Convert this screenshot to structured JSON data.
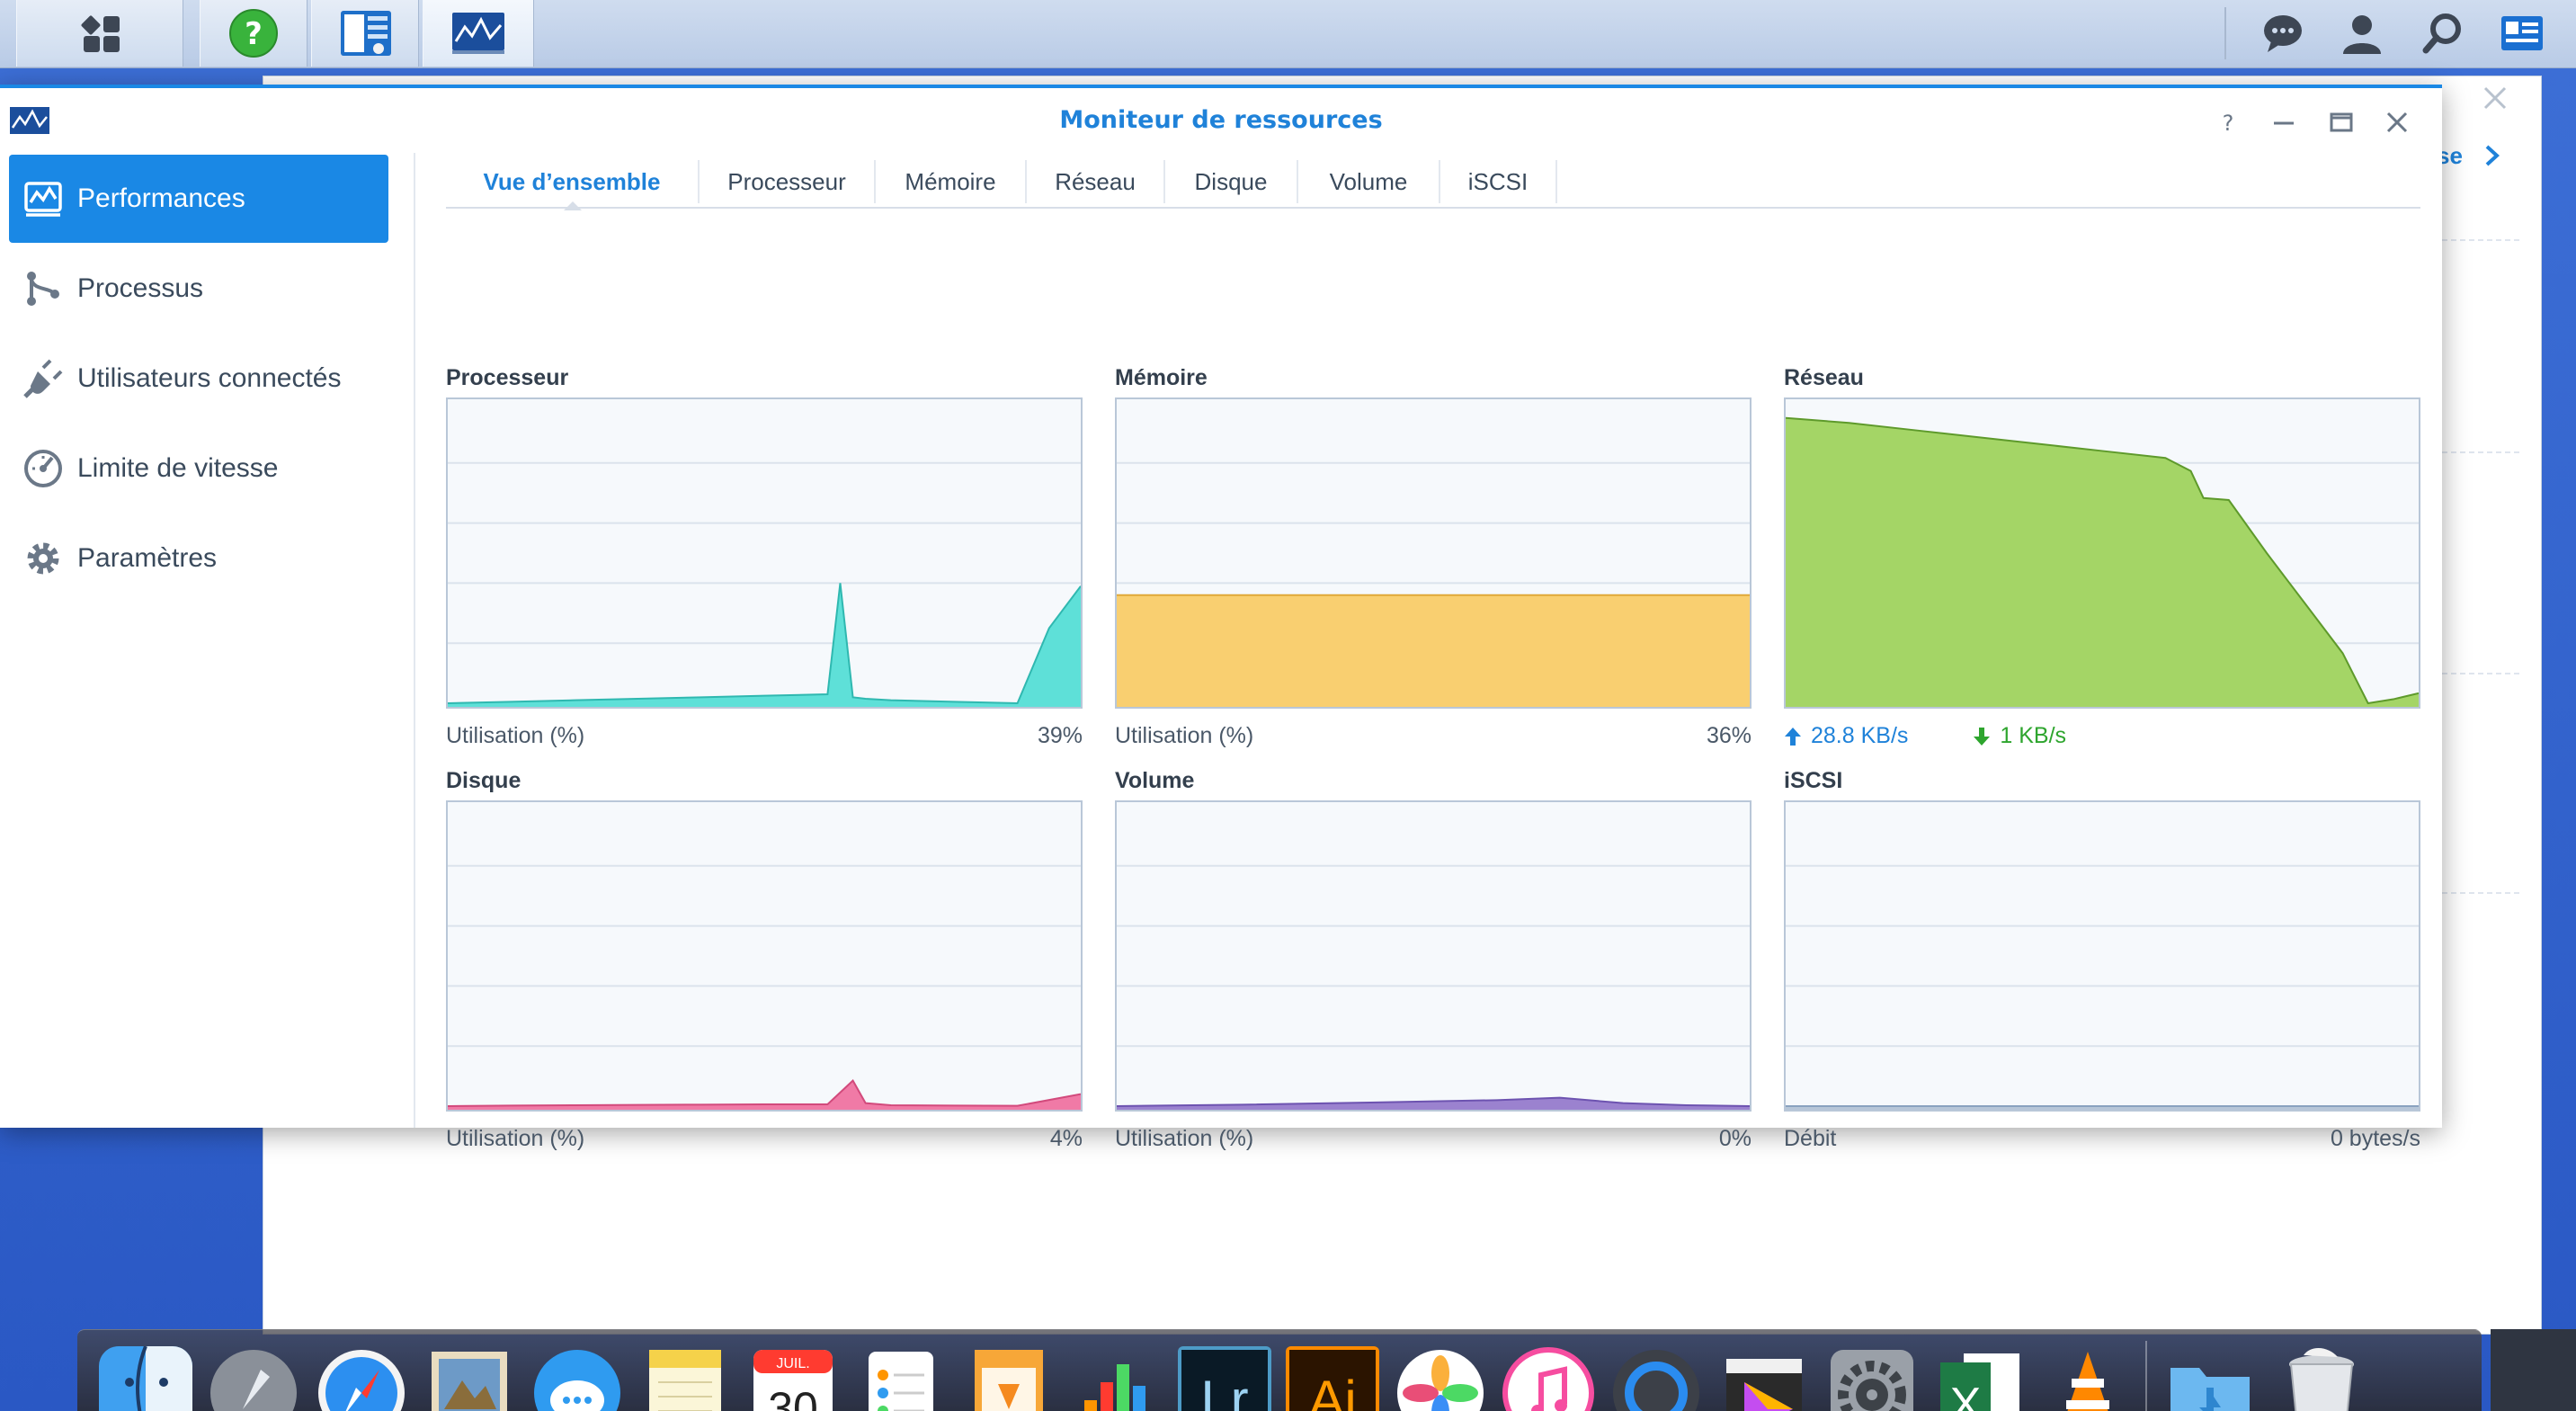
{
  "window": {
    "title": "Moniteur de ressources",
    "controls": [
      "help-icon",
      "minimize-icon",
      "maximize-icon",
      "close-icon"
    ]
  },
  "taskbar": {
    "left_icons": [
      "main-menu-icon",
      "help-center-icon",
      "package-center-icon",
      "resource-monitor-icon"
    ],
    "right_icons": [
      "notifications-icon",
      "user-icon",
      "search-icon",
      "widgets-icon"
    ]
  },
  "background_window": {
    "link_text": "se"
  },
  "sidebar": {
    "items": [
      {
        "label": "Performances",
        "icon": "performance-chart-icon",
        "active": true
      },
      {
        "label": "Processus",
        "icon": "process-icon",
        "active": false
      },
      {
        "label": "Utilisateurs connectés",
        "icon": "plug-icon",
        "active": false
      },
      {
        "label": "Limite de vitesse",
        "icon": "speed-gauge-icon",
        "active": false
      },
      {
        "label": "Paramètres",
        "icon": "gear-icon",
        "active": false
      }
    ]
  },
  "tabs": [
    {
      "label": "Vue d’ensemble",
      "active": true
    },
    {
      "label": "Processeur",
      "active": false
    },
    {
      "label": "Mémoire",
      "active": false
    },
    {
      "label": "Réseau",
      "active": false
    },
    {
      "label": "Disque",
      "active": false
    },
    {
      "label": "Volume",
      "active": false
    },
    {
      "label": "iSCSI",
      "active": false
    }
  ],
  "panels": {
    "cpu": {
      "title": "Processeur",
      "footer_label": "Utilisation (%)",
      "footer_value": "39%"
    },
    "memory": {
      "title": "Mémoire",
      "footer_label": "Utilisation (%)",
      "footer_value": "36%"
    },
    "network": {
      "title": "Réseau",
      "upload": "28.8 KB/s",
      "download": "1 KB/s"
    },
    "disk": {
      "title": "Disque",
      "footer_label": "Utilisation (%)",
      "footer_value": "4%"
    },
    "volume": {
      "title": "Volume",
      "footer_label": "Utilisation (%)",
      "footer_value": "0%"
    },
    "iscsi": {
      "title": "iSCSI",
      "footer_label": "Débit",
      "footer_value": "0 bytes/s"
    }
  },
  "colors": {
    "accent": "#1a88e5",
    "cpu": "#5ee0d8",
    "memory": "#f9cf70",
    "network": "#a4d566",
    "disk": "#f07aa6",
    "volume": "#9b82cf"
  },
  "chart_data": [
    {
      "type": "area",
      "name": "cpu",
      "x": [
        0,
        10,
        20,
        30,
        40,
        50,
        60,
        62,
        64,
        66,
        70,
        80,
        90,
        92,
        95,
        100
      ],
      "values": [
        0,
        0.5,
        1,
        1.5,
        2,
        2.5,
        3,
        40,
        2,
        1.5,
        1,
        0.5,
        0,
        10,
        25,
        39
      ],
      "ylim": [
        0,
        100
      ]
    },
    {
      "type": "area",
      "name": "memory",
      "x": [
        0,
        100
      ],
      "values": [
        36,
        36
      ],
      "ylim": [
        0,
        100
      ]
    },
    {
      "type": "area",
      "name": "network",
      "x": [
        0,
        10,
        20,
        30,
        40,
        50,
        60,
        64,
        66,
        70,
        76,
        82,
        88,
        92,
        96,
        100
      ],
      "values": [
        28.5,
        28,
        27.3,
        26.6,
        25.9,
        25.2,
        24.5,
        23.2,
        20.5,
        20.3,
        15,
        10,
        5,
        0,
        0.4,
        1
      ],
      "ylim": [
        0,
        30
      ]
    },
    {
      "type": "area",
      "name": "disk",
      "x": [
        0,
        10,
        20,
        30,
        40,
        50,
        60,
        64,
        66,
        70,
        80,
        90,
        100
      ],
      "values": [
        0,
        0.2,
        0.3,
        0.4,
        0.5,
        0.6,
        0.6,
        8.5,
        1,
        0.3,
        0.2,
        0.1,
        4
      ],
      "ylim": [
        0,
        100
      ]
    },
    {
      "type": "area",
      "name": "volume",
      "x": [
        0,
        20,
        40,
        60,
        70,
        80,
        90,
        100
      ],
      "values": [
        0,
        0.5,
        1.2,
        2,
        2.8,
        1,
        0.3,
        0
      ],
      "ylim": [
        0,
        100
      ]
    },
    {
      "type": "area",
      "name": "iscsi",
      "x": [
        0,
        100
      ],
      "values": [
        0,
        0
      ],
      "ylim": [
        0,
        1
      ]
    }
  ],
  "dock": {
    "icons": [
      "finder-icon",
      "launchpad-icon",
      "safari-icon",
      "mail-icon",
      "messages-icon",
      "notes-icon",
      "calendar-icon",
      "reminders-icon",
      "pages-icon",
      "numbers-icon",
      "lightroom-icon",
      "illustrator-icon",
      "photos-icon",
      "itunes-icon",
      "quicktime-icon",
      "final-cut-icon",
      "system-preferences-icon",
      "excel-icon",
      "vlc-icon",
      "downloads-folder-icon",
      "trash-icon"
    ],
    "calendar_month": "JUIL.",
    "calendar_day": "30",
    "lightroom_label": "Lr",
    "illustrator_label": "Ai",
    "excel_label": "X"
  }
}
